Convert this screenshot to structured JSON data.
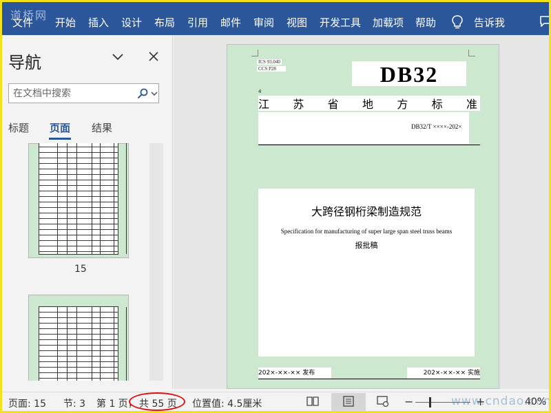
{
  "watermark": "道桥网",
  "ribbon": {
    "tabs": [
      "文件",
      "开始",
      "插入",
      "设计",
      "布局",
      "引用",
      "邮件",
      "审阅",
      "视图",
      "开发工具",
      "加载项",
      "帮助"
    ],
    "tell_me": "告诉我"
  },
  "nav": {
    "title": "导航",
    "search_placeholder": "在文档中搜索",
    "tabs": [
      "标题",
      "页面",
      "结果"
    ],
    "active_tab": "页面",
    "thumbnail_page_label": "15"
  },
  "document": {
    "ics": "ICS 93.040",
    "ccs": "CCS P28",
    "db_code": "DB32",
    "mark": "4",
    "province_chars": [
      "江",
      "苏",
      "省",
      "地",
      "方",
      "标",
      "准"
    ],
    "standard_number": "DB32/T ××××-202×",
    "title_cn": "大跨径钢桁梁制造规范",
    "title_en": "Specification for manufacturing of super large span steel truss beams",
    "stage": "报批稿",
    "issue_date": "202×-××-×× 发布",
    "implement_date": "202×-××-×× 实施"
  },
  "status": {
    "page": "页面: 15",
    "section": "节: 3",
    "page_of": "第 1 页，",
    "total_pages": "共 55 页",
    "position": "位置值: 4.5厘米",
    "zoom": "40%",
    "watermark": "www.cndao.com"
  },
  "colors": {
    "ribbon": "#2b579a",
    "page_bg": "#cce8cf",
    "annotation_ring": "#e01010",
    "border": "#f3e21a"
  }
}
